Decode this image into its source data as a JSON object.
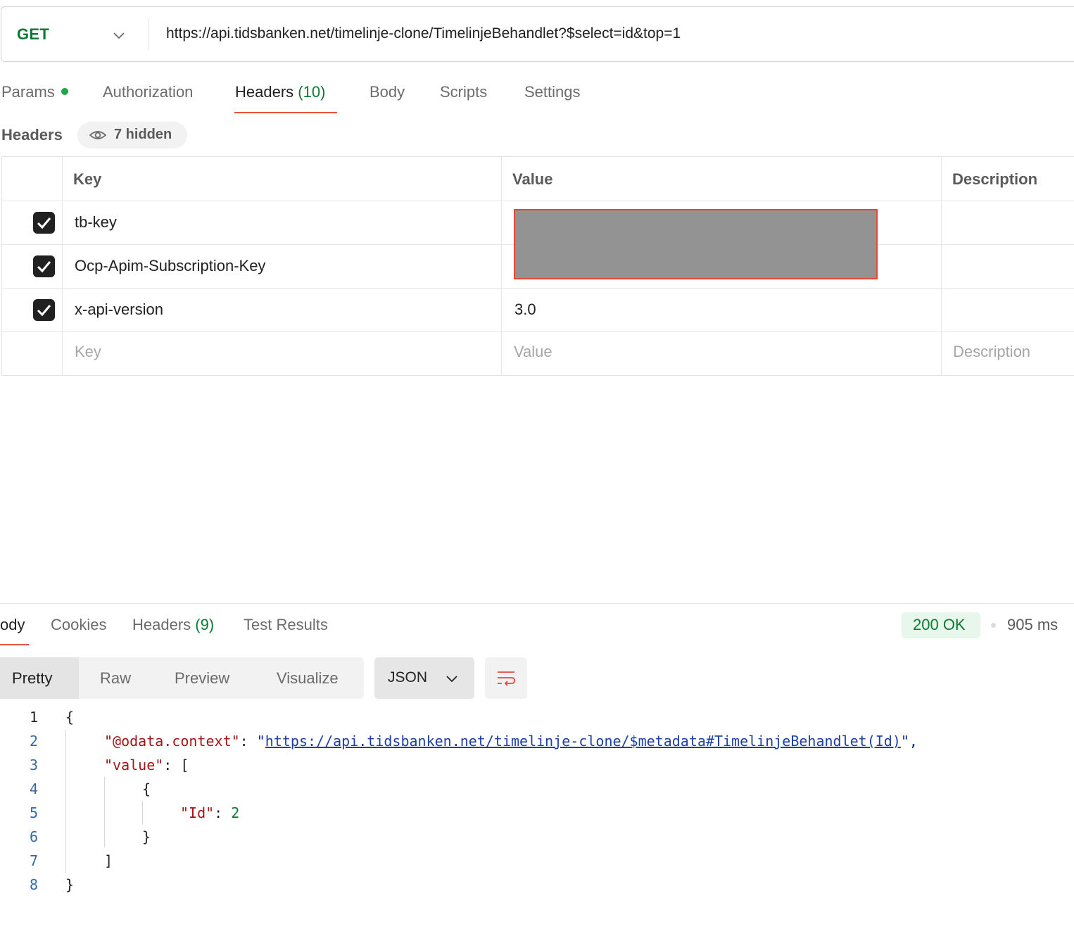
{
  "request": {
    "method": "GET",
    "url": "https://api.tidsbanken.net/timelinje-clone/TimelinjeBehandlet?$select=id&top=1"
  },
  "request_tabs": [
    {
      "label": "Params",
      "count": ""
    },
    {
      "label": "Authorization",
      "count": ""
    },
    {
      "label": "Headers",
      "count": "(10)"
    },
    {
      "label": "Body",
      "count": ""
    },
    {
      "label": "Scripts",
      "count": ""
    },
    {
      "label": "Settings",
      "count": ""
    }
  ],
  "headers_section": {
    "title": "Headers",
    "hidden_label": "7 hidden",
    "columns": {
      "key": "Key",
      "value": "Value",
      "description": "Description"
    },
    "rows": [
      {
        "key": "tb-key",
        "value": "",
        "checked": true
      },
      {
        "key": "Ocp-Apim-Subscription-Key",
        "value": "",
        "checked": true
      },
      {
        "key": "x-api-version",
        "value": "3.0",
        "checked": true
      }
    ],
    "placeholders": {
      "key": "Key",
      "value": "Value",
      "description": "Description"
    }
  },
  "response": {
    "tabs": [
      {
        "label": "ody",
        "count": ""
      },
      {
        "label": "Cookies",
        "count": ""
      },
      {
        "label": "Headers",
        "count": "(9)"
      },
      {
        "label": "Test Results",
        "count": ""
      }
    ],
    "status": "200 OK",
    "time": "905 ms",
    "view_modes": [
      "Pretty",
      "Raw",
      "Preview",
      "Visualize"
    ],
    "format": "JSON",
    "line_numbers": [
      "1",
      "2",
      "3",
      "4",
      "5",
      "6",
      "7",
      "8"
    ],
    "code": {
      "open_brace": "{",
      "context_key": "\"@odata.context\"",
      "context_colon": ": ",
      "context_quote_open": "\"",
      "context_url": "https://api.tidsbanken.net/timelinje-clone/$metadata#TimelinjeBehandlet(Id)",
      "context_quote_close": "\",",
      "value_key": "\"value\"",
      "value_rest": ": [",
      "inner_open": "{",
      "id_key": "\"Id\"",
      "id_colon": ": ",
      "id_value": "2",
      "inner_close": "}",
      "array_close": "]",
      "close_brace": "}"
    }
  }
}
